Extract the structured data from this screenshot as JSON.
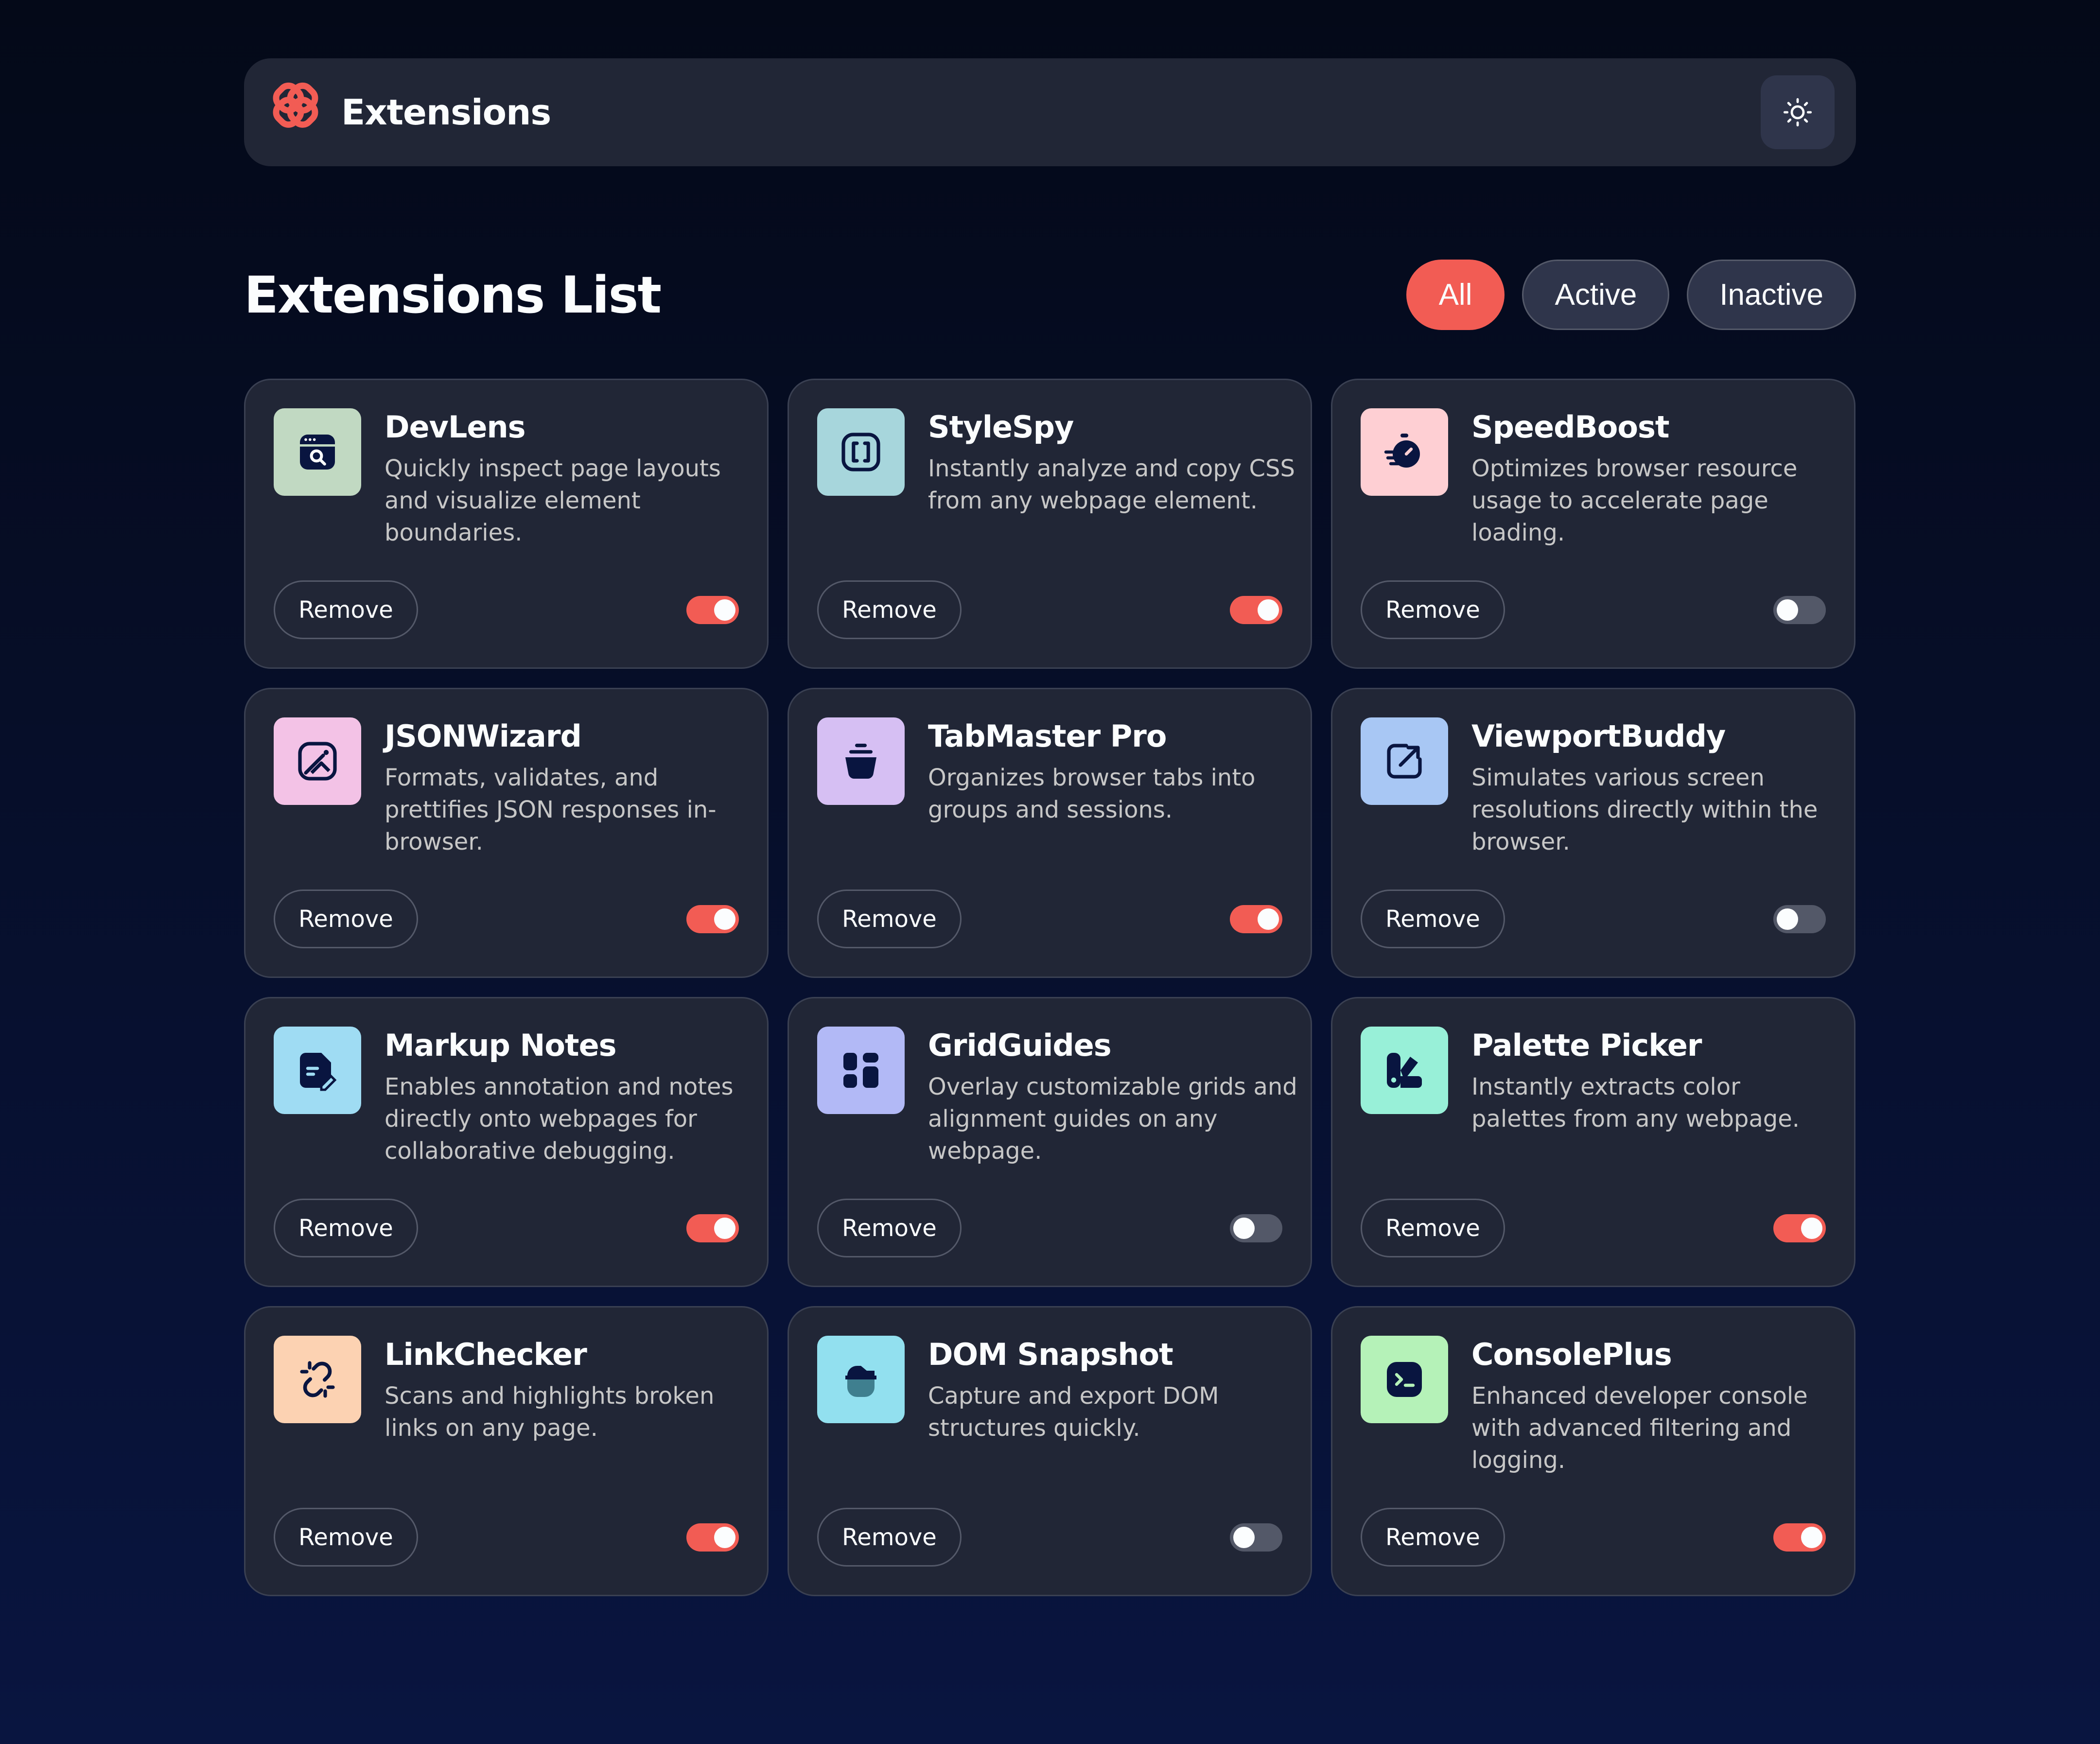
{
  "header": {
    "brand_name": "Extensions",
    "logo_icon": "flower-knot-logo",
    "theme_toggle_icon": "sun-icon"
  },
  "list": {
    "title": "Extensions List",
    "filters": [
      {
        "label": "All",
        "selected": true
      },
      {
        "label": "Active",
        "selected": false
      },
      {
        "label": "Inactive",
        "selected": false
      }
    ]
  },
  "remove_label": "Remove",
  "colors": {
    "accent": "#f25c54",
    "card": "#212636",
    "toggle_off": "#535868"
  },
  "extensions": [
    {
      "name": "DevLens",
      "description": "Quickly inspect page layouts and visualize element boundaries.",
      "icon": "browser-search-icon",
      "icon_bg": "#c1d9c2",
      "active": true
    },
    {
      "name": "StyleSpy",
      "description": "Instantly analyze and copy CSS from any webpage element.",
      "icon": "code-brackets-icon",
      "icon_bg": "#a7d6dc",
      "active": true
    },
    {
      "name": "SpeedBoost",
      "description": "Optimizes browser resource usage to accelerate page loading.",
      "icon": "stopwatch-icon",
      "icon_bg": "#fecfd3",
      "active": false
    },
    {
      "name": "JSONWizard",
      "description": "Formats, validates, and prettifies JSON responses in-browser.",
      "icon": "magic-wand-image-icon",
      "icon_bg": "#f3c2e6",
      "active": true
    },
    {
      "name": "TabMaster Pro",
      "description": "Organizes browser tabs into groups and sessions.",
      "icon": "tab-stack-icon",
      "icon_bg": "#d6bff3",
      "active": true
    },
    {
      "name": "ViewportBuddy",
      "description": "Simulates various screen resolutions directly within the browser.",
      "icon": "resize-arrow-icon",
      "icon_bg": "#a8c7f4",
      "active": false
    },
    {
      "name": "Markup Notes",
      "description": "Enables annotation and notes directly onto webpages for collaborative debugging.",
      "icon": "note-pen-icon",
      "icon_bg": "#9fdcf3",
      "active": true
    },
    {
      "name": "GridGuides",
      "description": "Overlay customizable grids and alignment guides on any webpage.",
      "icon": "grid-layout-icon",
      "icon_bg": "#b2b9f6",
      "active": false
    },
    {
      "name": "Palette Picker",
      "description": "Instantly extracts color palettes from any webpage.",
      "icon": "palette-icon",
      "icon_bg": "#98f0d8",
      "active": true
    },
    {
      "name": "LinkChecker",
      "description": "Scans and highlights broken links on any page.",
      "icon": "broken-link-icon",
      "icon_bg": "#fcd2b2",
      "active": true
    },
    {
      "name": "DOM Snapshot",
      "description": "Capture and export DOM structures quickly.",
      "icon": "snapshot-icon",
      "icon_bg": "#92e0ef",
      "active": false
    },
    {
      "name": "ConsolePlus",
      "description": "Enhanced developer console with advanced filtering and logging.",
      "icon": "terminal-icon",
      "icon_bg": "#b5f2b8",
      "active": true
    }
  ]
}
